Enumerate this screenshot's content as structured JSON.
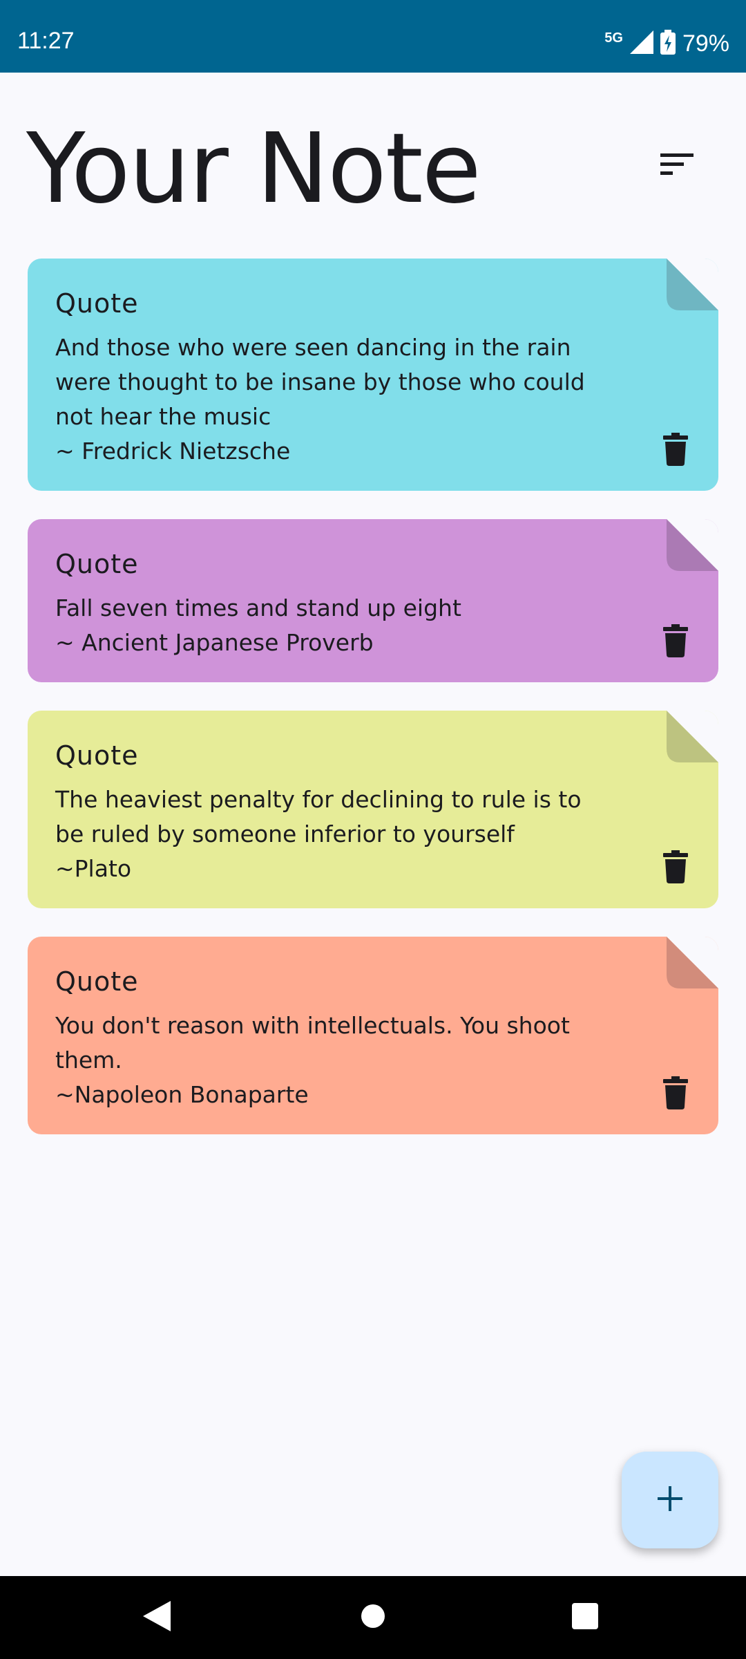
{
  "status_bar": {
    "time": "11:27",
    "network": "5G",
    "battery": "79%"
  },
  "header": {
    "title": "Your Note",
    "sort_icon": "sort-icon"
  },
  "notes": [
    {
      "title": "Quote",
      "content": "And those who were seen dancing in the rain were thought to be insane by those who could not hear the music\n~ Fredrick Nietzsche",
      "color": "#81deea",
      "fold_color": "#6fb6c2"
    },
    {
      "title": "Quote",
      "content": "Fall seven times and stand up eight\n~ Ancient Japanese Proverb",
      "color": "#cf93d9",
      "fold_color": "#ab7ab4"
    },
    {
      "title": "Quote",
      "content": "The heaviest penalty for declining to rule is to be ruled by someone inferior to yourself\n~Plato",
      "color": "#e6ec98",
      "fold_color": "#bdc380"
    },
    {
      "title": "Quote",
      "content": "You don't reason with intellectuals. You shoot them.\n~Napoleon Bonaparte",
      "color": "#ffab91",
      "fold_color": "#d28c7b"
    }
  ],
  "fab": {
    "icon": "plus-icon",
    "color": "#cae6ff"
  },
  "nav_bar": {
    "back_icon": "back-icon",
    "home_icon": "home-icon",
    "recents_icon": "recents-icon"
  }
}
